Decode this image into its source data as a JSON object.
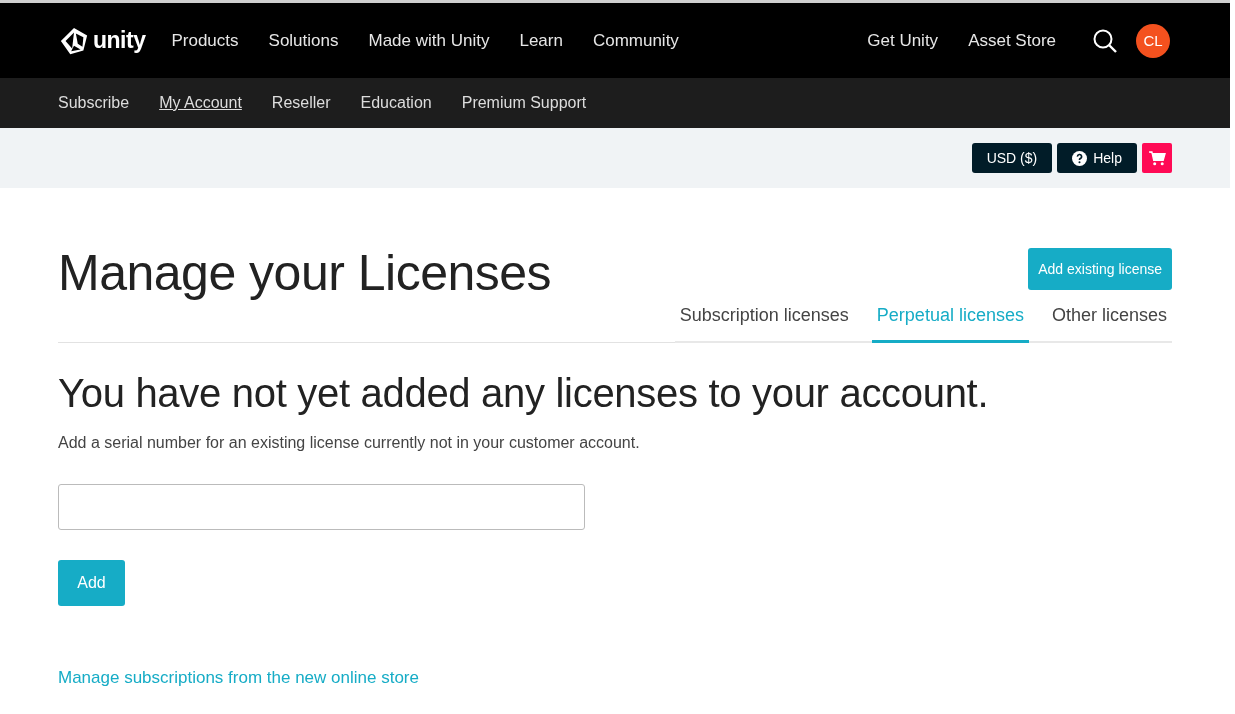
{
  "header": {
    "logo": "unity",
    "nav": [
      {
        "label": "Products"
      },
      {
        "label": "Solutions"
      },
      {
        "label": "Made with Unity"
      },
      {
        "label": "Learn"
      },
      {
        "label": "Community"
      }
    ],
    "nav_right": [
      {
        "label": "Get Unity"
      },
      {
        "label": "Asset Store"
      }
    ],
    "avatar": "CL"
  },
  "subnav": [
    {
      "label": "Subscribe",
      "selected": false
    },
    {
      "label": "My Account",
      "selected": true
    },
    {
      "label": "Reseller",
      "selected": false
    },
    {
      "label": "Education",
      "selected": false
    },
    {
      "label": "Premium Support",
      "selected": false
    }
  ],
  "toolbar": {
    "currency": "USD ($)",
    "help": "Help"
  },
  "page": {
    "title": "Manage your Licenses",
    "add_button": "Add existing license",
    "tabs": [
      {
        "label": "Subscription licenses",
        "selected": false
      },
      {
        "label": "Perpetual licenses",
        "selected": true
      },
      {
        "label": "Other licenses",
        "selected": false
      }
    ],
    "heading": "You have not yet added any licenses to your account.",
    "description": "Add a serial number for an existing license currently not in your customer account.",
    "submit": "Add",
    "link": "Manage subscriptions from the new online store"
  }
}
